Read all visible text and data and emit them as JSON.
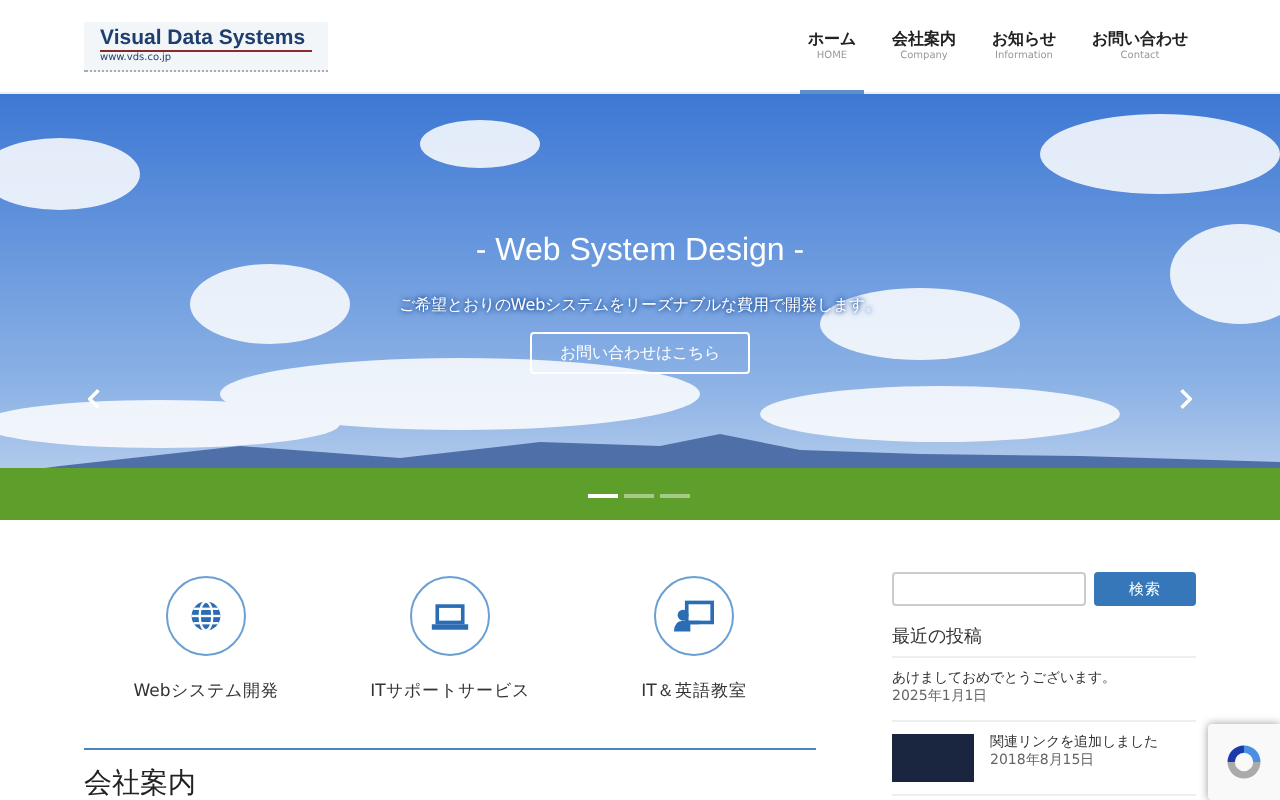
{
  "logo": {
    "title": "Visual Data Systems",
    "url": "www.vds.co.jp"
  },
  "nav": [
    {
      "label": "ホーム",
      "sub": "HOME",
      "selected": true
    },
    {
      "label": "会社案内",
      "sub": "Company",
      "selected": false
    },
    {
      "label": "お知らせ",
      "sub": "Information",
      "selected": false
    },
    {
      "label": "お問い合わせ",
      "sub": "Contact",
      "selected": false
    }
  ],
  "hero": {
    "title": "- Web System Design -",
    "subtitle": "ご希望とおりのWebシステムをリーズナブルな費用で開発します。",
    "button": "お問い合わせはこちら",
    "slides": [
      {
        "selected": true
      },
      {
        "selected": false
      },
      {
        "selected": false
      }
    ]
  },
  "services": [
    {
      "kind": "globe",
      "label": "Webシステム開発"
    },
    {
      "kind": "laptop",
      "label": "ITサポートサービス"
    },
    {
      "kind": "teacher",
      "label": "IT＆英語教室"
    }
  ],
  "section_title": "会社案内",
  "sidebar": {
    "search_button": "検索",
    "heading": "最近の投稿",
    "posts": [
      {
        "title": "あけましておめでとうございます。",
        "date": "2025年1月1日",
        "thumbnail": false
      },
      {
        "title": "関連リンクを追加しました",
        "date": "2018年8月15日",
        "thumbnail": true
      }
    ]
  }
}
